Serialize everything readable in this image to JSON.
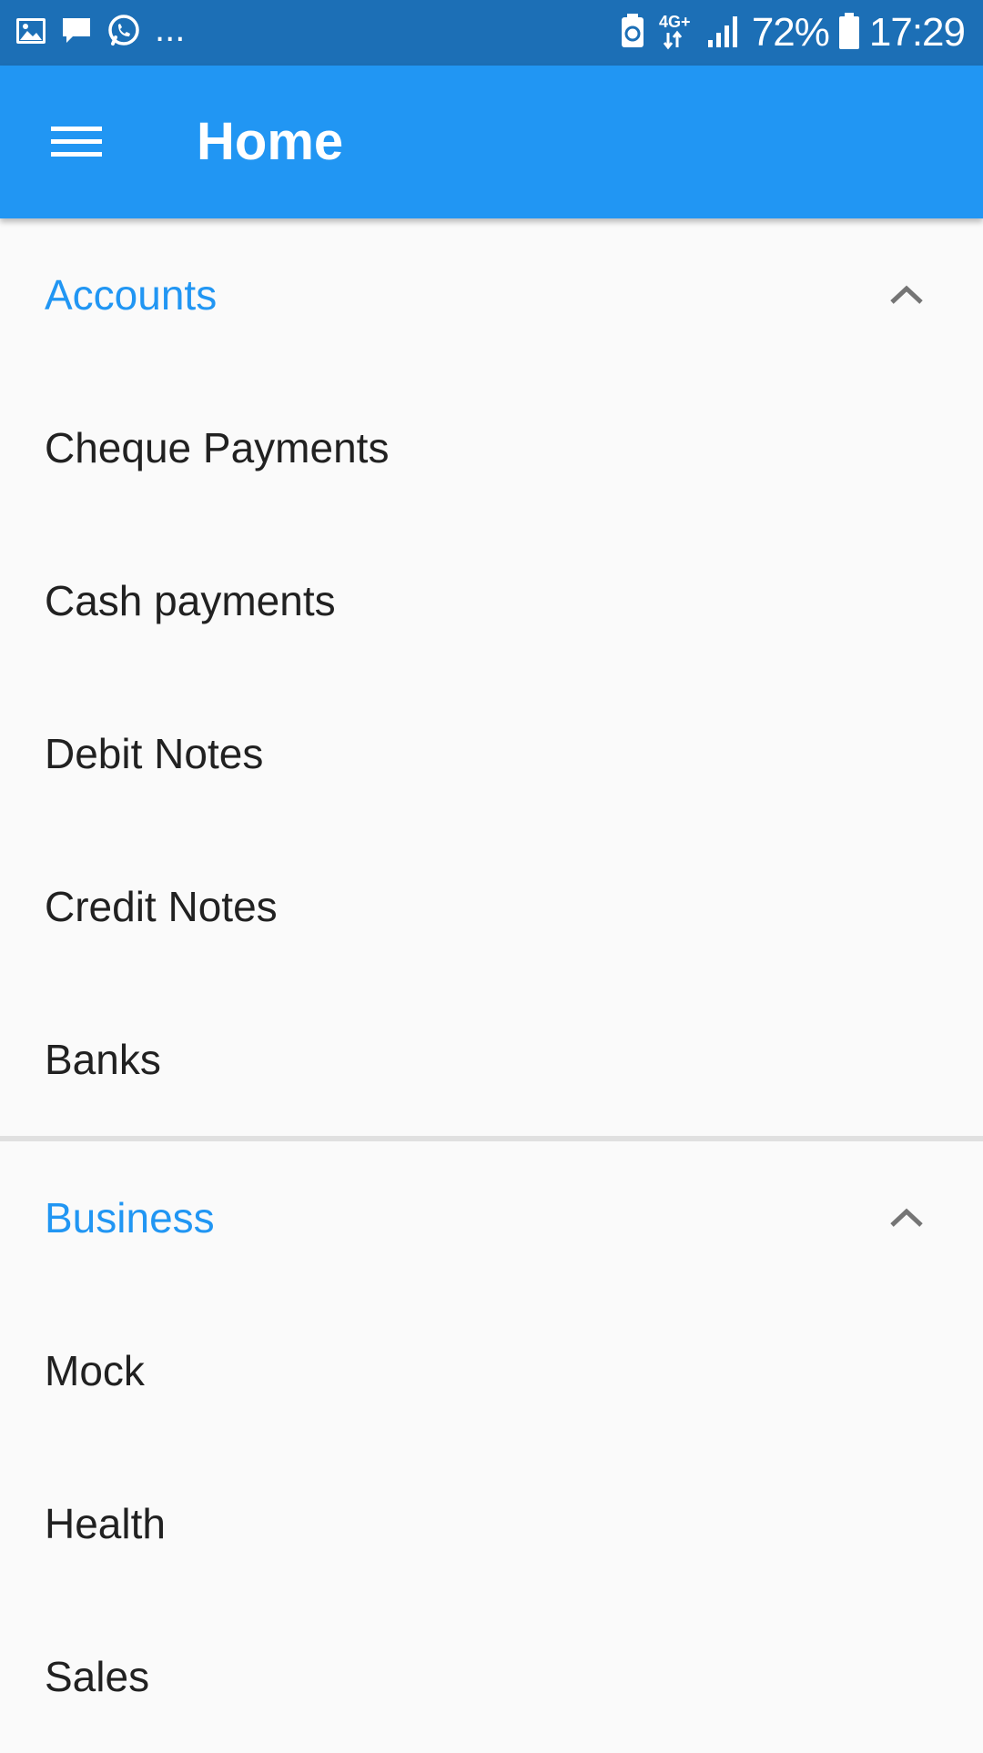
{
  "status_bar": {
    "overflow_indicator": "...",
    "network": "4G+",
    "battery": "72%",
    "time": "17:29",
    "icons_left": [
      "gallery-icon",
      "message-icon",
      "whatsapp-icon"
    ],
    "icons_right": [
      "battery-saver-icon",
      "network-icon",
      "signal-icon",
      "battery-icon"
    ]
  },
  "app_bar": {
    "title": "Home",
    "background": "#2196f3",
    "menu_icon": "hamburger-icon"
  },
  "sections": [
    {
      "title": "Accounts",
      "expanded": true,
      "items": [
        "Cheque Payments",
        "Cash payments",
        "Debit Notes",
        "Credit Notes",
        "Banks"
      ]
    },
    {
      "title": "Business",
      "expanded": true,
      "items": [
        "Mock",
        "Health",
        "Sales"
      ]
    }
  ],
  "colors": {
    "accent": "#2196f3",
    "status_bar": "#1c6fb6",
    "text_primary": "#212121",
    "background": "#fafafa"
  }
}
